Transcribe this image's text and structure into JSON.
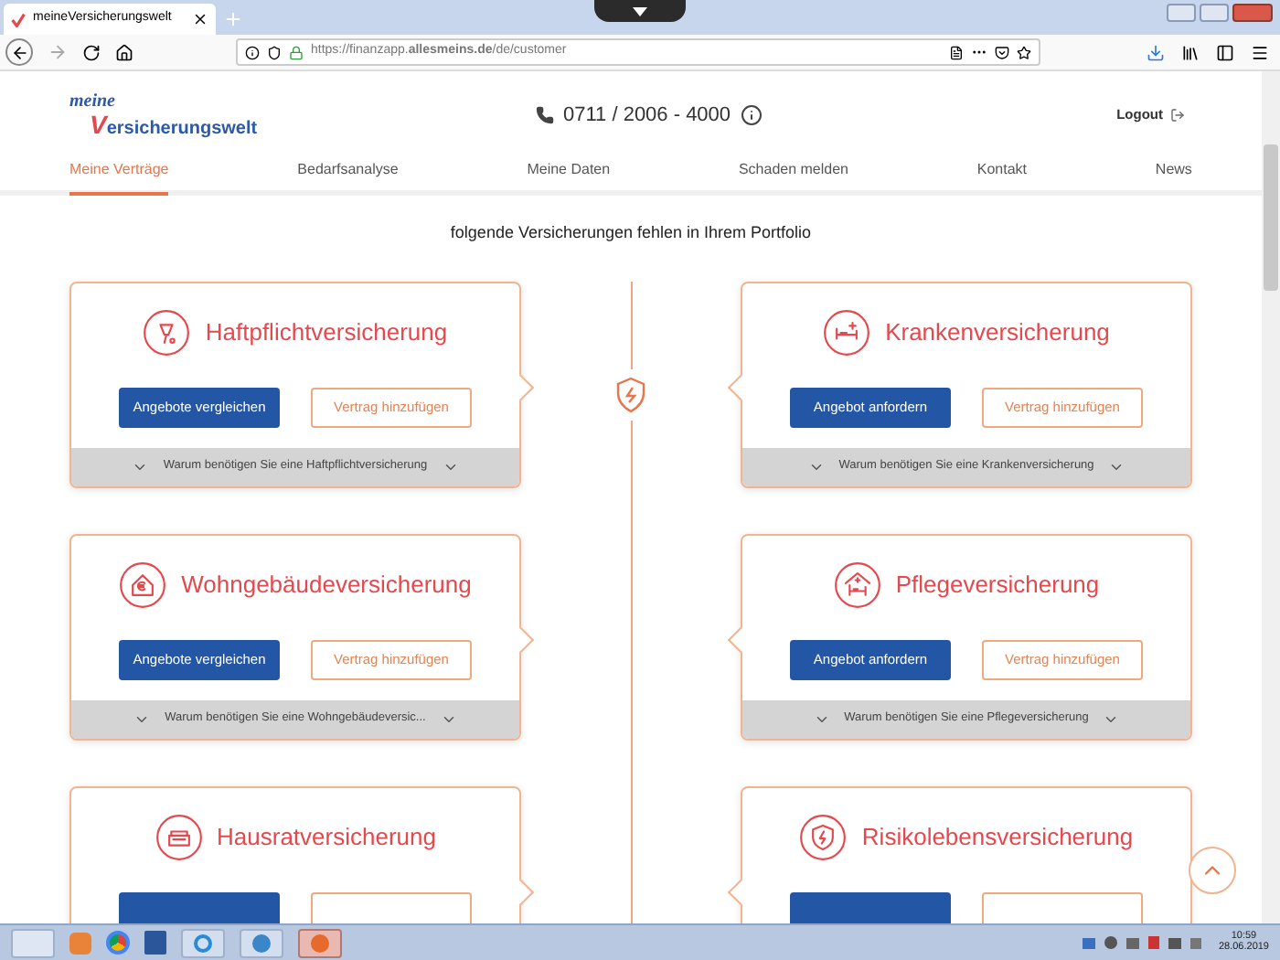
{
  "browser": {
    "tab_title": "meineVersicherungswelt",
    "url": "https://finanzapp.**allesmeins.de**/de/customer"
  },
  "header": {
    "logo": {
      "line1": "meine",
      "initial": "V",
      "rest": "ersicherungswelt"
    },
    "phone": "0711 / 2006 - 4000",
    "logout": "Logout"
  },
  "nav": [
    {
      "label": "Meine Verträge",
      "selected": true
    },
    {
      "label": "Bedarfsanalyse",
      "selected": false
    },
    {
      "label": "Meine Daten",
      "selected": false
    },
    {
      "label": "Schaden melden",
      "selected": false
    },
    {
      "label": "Kontakt",
      "selected": false
    },
    {
      "label": "News",
      "selected": false
    }
  ],
  "heading": "folgende Versicherungen fehlen in Ihrem Portfolio",
  "cards": [
    {
      "title": "Haftpflichtversicherung",
      "buttons": [
        {
          "kind": "primary",
          "label": "Angebote vergleichen"
        },
        {
          "kind": "outline",
          "label": "Vertrag hinzufügen"
        }
      ],
      "footer": "Warum benötigen Sie eine Haftpflichtversicherung"
    },
    {
      "title": "Krankenversicherung",
      "buttons": [
        {
          "kind": "primary",
          "label": "Angebot anfordern"
        },
        {
          "kind": "outline",
          "label": "Vertrag hinzufügen"
        }
      ],
      "footer": "Warum benötigen Sie eine Krankenversicherung"
    },
    {
      "title": "Wohngebäudeversicherung",
      "buttons": [
        {
          "kind": "primary",
          "label": "Angebote vergleichen"
        },
        {
          "kind": "outline",
          "label": "Vertrag hinzufügen"
        }
      ],
      "footer": "Warum benötigen Sie eine Wohngebäudeversic..."
    },
    {
      "title": "Pflegeversicherung",
      "buttons": [
        {
          "kind": "primary",
          "label": "Angebot anfordern"
        },
        {
          "kind": "outline",
          "label": "Vertrag hinzufügen"
        }
      ],
      "footer": "Warum benötigen Sie eine Pflegeversicherung"
    },
    {
      "title": "Hausratversicherung",
      "buttons": [
        {
          "kind": "primary"
        },
        {
          "kind": "outline"
        }
      ]
    },
    {
      "title": "Risikolebensversicherung",
      "buttons": [
        {
          "kind": "primary"
        },
        {
          "kind": "outline"
        }
      ]
    }
  ],
  "taskbar": {
    "time": "10:59",
    "date": "28.06.2019"
  }
}
